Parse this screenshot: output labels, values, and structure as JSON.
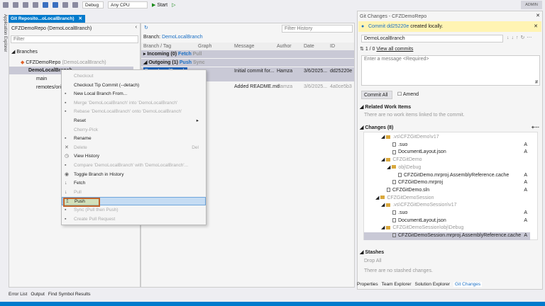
{
  "toolbar": {
    "config": "Debug",
    "platform": "Any CPU",
    "start": "Start",
    "user": "ADMIN"
  },
  "side_label": "Application Explorer",
  "doc_tab": {
    "title": "Git Reposito...oLocalBranch)"
  },
  "left": {
    "repo_title": "CFZDemoRepo (DemoLocalBranch)",
    "filter_placeholder": "Filter",
    "branches_label": "Branches",
    "repo_node": "CFZDemoRepo",
    "repo_node_branch": "(DemoLocalBranch)",
    "items": [
      "DemoLocalBranch",
      "main",
      "remotes/origin"
    ]
  },
  "history": {
    "branch_label": "Branch:",
    "branch": "DemoLocalBranch",
    "filter_placeholder": "Filter History",
    "columns": [
      "Branch / Tag",
      "Graph",
      "Message",
      "Author",
      "Date",
      "ID"
    ],
    "incoming": "Incoming (0)",
    "fetch": "Fetch",
    "pull": "Pull",
    "outgoing": "Outgoing (1)",
    "push": "Push",
    "sync": "Sync",
    "commits": [
      {
        "tag": "DemoLocalBranch",
        "message": "Initial commit for...",
        "author": "Hamza",
        "date": "3/6/2025...",
        "id": "dd25220e"
      },
      {
        "tag": "",
        "message": "Added README.md",
        "author": "Hamza",
        "date": "3/6/2025...",
        "id": "4a0ce5b3"
      }
    ]
  },
  "menu": [
    {
      "label": "Checkout",
      "disabled": true,
      "icon": ""
    },
    {
      "label": "Checkout Tip Commit (--detach)",
      "disabled": false,
      "icon": ""
    },
    {
      "label": "New Local Branch From...",
      "disabled": false,
      "icon": "branch-icon"
    },
    {
      "label": "Merge 'DemoLocalBranch' into 'DemoLocalBranch'",
      "disabled": true,
      "icon": "merge-icon"
    },
    {
      "label": "Rebase 'DemoLocalBranch' onto 'DemoLocalBranch'",
      "disabled": true,
      "icon": "rebase-icon"
    },
    {
      "label": "Reset",
      "disabled": false,
      "icon": "",
      "submenu": true
    },
    {
      "label": "Cherry-Pick",
      "disabled": true,
      "icon": ""
    },
    {
      "label": "Rename",
      "disabled": false,
      "icon": "rename-icon"
    },
    {
      "label": "Delete",
      "disabled": true,
      "icon": "delete-icon",
      "shortcut": "Del"
    },
    {
      "label": "View History",
      "disabled": false,
      "icon": "history-icon"
    },
    {
      "label": "Compare 'DemoLocalBranch' with 'DemoLocalBranch'...",
      "disabled": true,
      "icon": "compare-icon"
    },
    {
      "label": "Toggle Branch in History",
      "disabled": false,
      "icon": "eye-icon"
    },
    {
      "label": "Fetch",
      "disabled": false,
      "icon": "fetch-icon"
    },
    {
      "label": "Pull",
      "disabled": true,
      "icon": "pull-icon"
    },
    {
      "label": "Push",
      "disabled": false,
      "icon": "push-icon",
      "highlighted": true
    },
    {
      "label": "Sync (Pull then Push)",
      "disabled": true,
      "icon": "sync-icon"
    },
    {
      "label": "Create Pull Request",
      "disabled": true,
      "icon": "pull-request-icon"
    }
  ],
  "git_changes": {
    "title": "Git Changes - CFZDemoRepo",
    "banner_prefix": "Commit",
    "banner_commit": "dd25220e",
    "banner_suffix": "created locally.",
    "branch": "DemoLocalBranch",
    "counts": "1 / 0",
    "view_all": "View all commits",
    "message_placeholder": "Enter a message <Required>",
    "commit_all": "Commit All",
    "amend": "Amend",
    "related": "Related Work Items",
    "related_empty": "There are no work items linked to the commit.",
    "changes": "Changes (8)",
    "tree": [
      {
        "label": ".vs\\CFZGitDemo\\v17",
        "type": "folder",
        "indent": 3,
        "status": ""
      },
      {
        "label": ".suo",
        "type": "file",
        "indent": 5,
        "status": "A"
      },
      {
        "label": "DocumentLayout.json",
        "type": "file",
        "indent": 5,
        "status": "A"
      },
      {
        "label": "CFZGitDemo",
        "type": "folder",
        "indent": 3,
        "status": ""
      },
      {
        "label": "obj\\Debug",
        "type": "folder",
        "indent": 4,
        "status": ""
      },
      {
        "label": "CFZGitDemo.mrproj.AssemblyReference.cache",
        "type": "file",
        "indent": 6,
        "status": "A"
      },
      {
        "label": "CFZGitDemo.mrproj",
        "type": "file",
        "indent": 5,
        "status": "A"
      },
      {
        "label": "CFZGitDemo.sln",
        "type": "file",
        "indent": 4,
        "status": "A"
      },
      {
        "label": "CFZGitDemoSession",
        "type": "folder",
        "indent": 2,
        "status": ""
      },
      {
        "label": ".vs\\CFZGitDemoSession\\v17",
        "type": "folder",
        "indent": 3,
        "status": ""
      },
      {
        "label": ".suo",
        "type": "file",
        "indent": 5,
        "status": "A"
      },
      {
        "label": "DocumentLayout.json",
        "type": "file",
        "indent": 5,
        "status": "A"
      },
      {
        "label": "CFZGitDemoSession\\obj\\Debug",
        "type": "folder",
        "indent": 3,
        "status": ""
      },
      {
        "label": "CFZGitDemoSession.mrproj.AssemblyReference.cache",
        "type": "file",
        "indent": 5,
        "status": "A",
        "selected": true
      }
    ],
    "stashes": "Stashes",
    "drop_all": "Drop All",
    "stash_empty": "There are no stashed changes."
  },
  "right_tabs": [
    "Properties",
    "Team Explorer",
    "Solution Explorer",
    "Git Changes"
  ],
  "bottom_tabs": [
    "Error List",
    "Output",
    "Find Symbol Results"
  ]
}
